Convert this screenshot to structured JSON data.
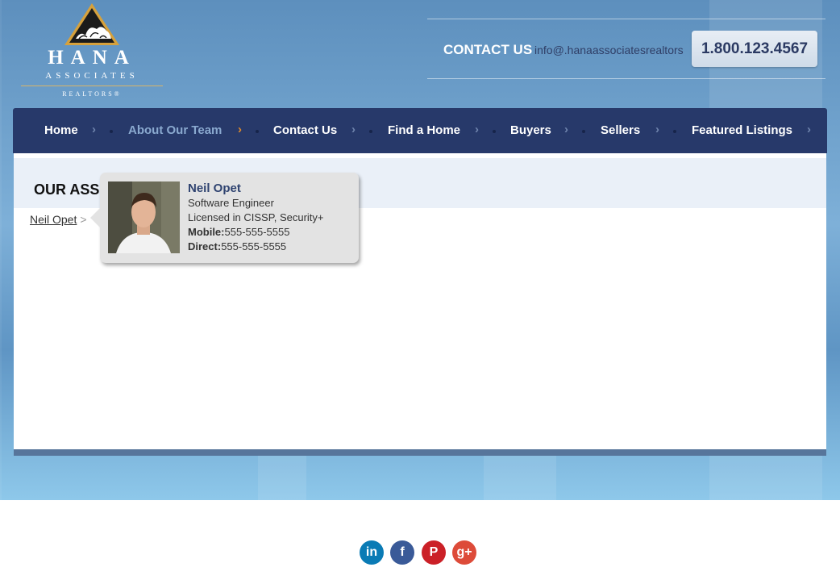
{
  "brand": {
    "name": "HANA",
    "sub": "ASSOCIATES",
    "tagline": "REALTORS®"
  },
  "contact": {
    "label": "CONTACT US",
    "email": "info@.hanaassociatesrealtors",
    "phone": "1.800.123.4567"
  },
  "nav": {
    "items": [
      {
        "label": "Home"
      },
      {
        "label": "About Our Team",
        "active": true
      },
      {
        "label": "Contact Us"
      },
      {
        "label": "Find a Home"
      },
      {
        "label": "Buyers"
      },
      {
        "label": "Sellers"
      },
      {
        "label": "Featured Listings"
      }
    ]
  },
  "page": {
    "title": "OUR ASSOCIATES",
    "breadcrumb_link": "Neil Opet",
    "breadcrumb_sep": ">"
  },
  "profile": {
    "name": "Neil Opet",
    "role": "Software Engineer",
    "license": "Licensed in CISSP, Security+",
    "mobile_label": "Mobile:",
    "mobile": "555-555-5555",
    "direct_label": "Direct:",
    "direct": "555-555-5555"
  },
  "social": [
    {
      "name": "linkedin",
      "glyph": "in",
      "color": "#0a7bb5"
    },
    {
      "name": "facebook",
      "glyph": "f",
      "color": "#3a5a98"
    },
    {
      "name": "pinterest",
      "glyph": "P",
      "color": "#cb2027"
    },
    {
      "name": "google-plus",
      "glyph": "g+",
      "color": "#dd4b39"
    }
  ],
  "colors": {
    "nav_bg": "#27396a",
    "accent": "#e08a2a",
    "active_nav": "#8aa9cf"
  }
}
